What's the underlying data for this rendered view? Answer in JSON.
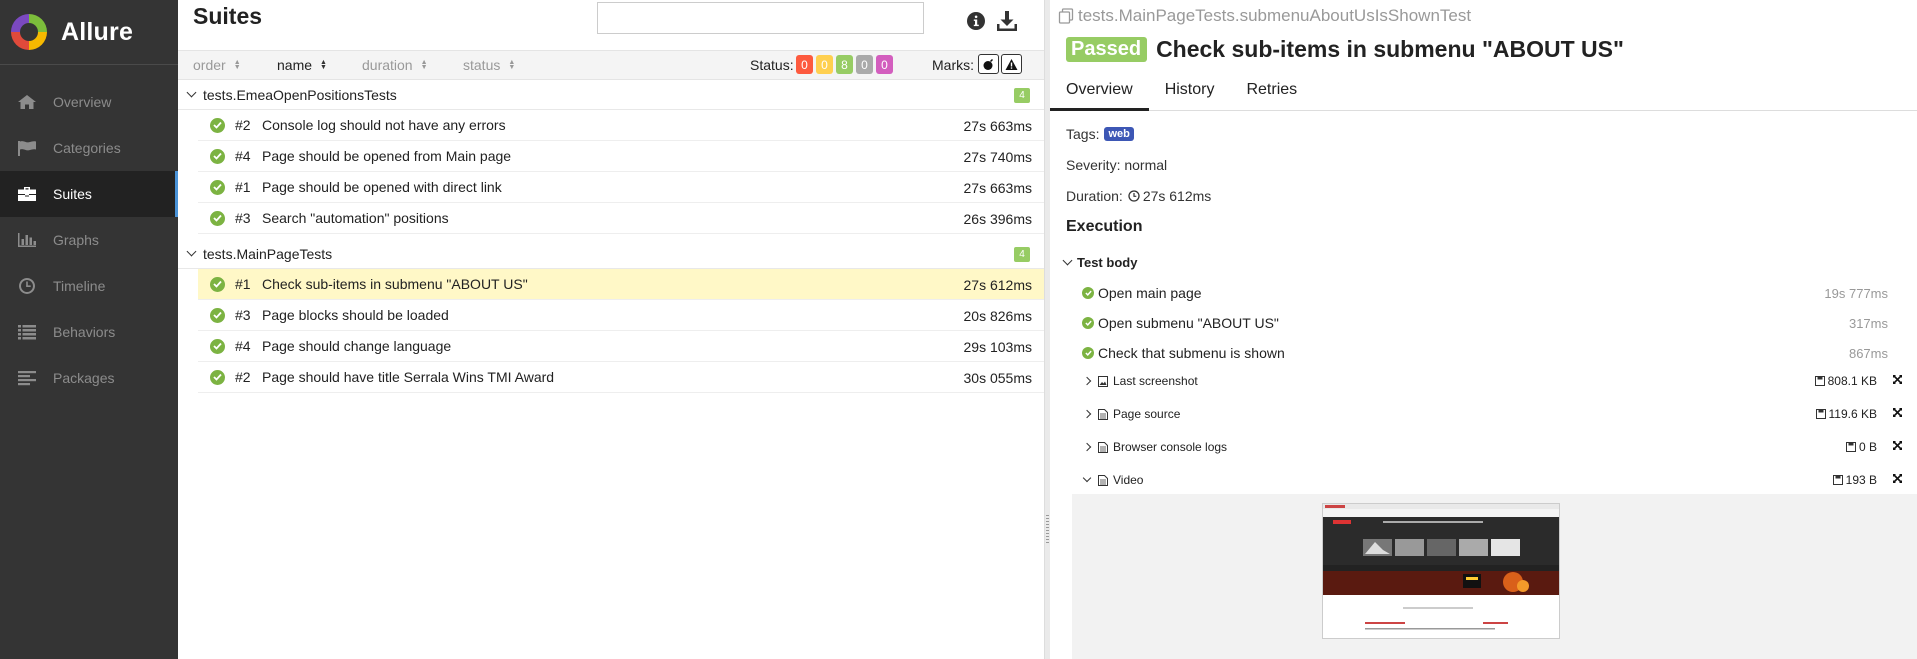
{
  "app": {
    "brand": "Allure",
    "nav": [
      {
        "label": "Overview",
        "icon": "home-icon"
      },
      {
        "label": "Categories",
        "icon": "flag-icon"
      },
      {
        "label": "Suites",
        "icon": "briefcase-icon",
        "active": true
      },
      {
        "label": "Graphs",
        "icon": "bar-chart-icon"
      },
      {
        "label": "Timeline",
        "icon": "clock-icon"
      },
      {
        "label": "Behaviors",
        "icon": "list-icon"
      },
      {
        "label": "Packages",
        "icon": "align-left-icon"
      }
    ]
  },
  "suites": {
    "title": "Suites",
    "search_value": "",
    "sort": {
      "order": "order",
      "name": "name",
      "duration": "duration",
      "status": "status"
    },
    "status_label": "Status:",
    "status_counts": [
      {
        "value": "0",
        "color": "#fd5a3e"
      },
      {
        "value": "0",
        "color": "#ffd050"
      },
      {
        "value": "8",
        "color": "#97cc64"
      },
      {
        "value": "0",
        "color": "#aaaaaa"
      },
      {
        "value": "0",
        "color": "#d35ebe"
      }
    ],
    "marks_label": "Marks:",
    "groups": [
      {
        "name": "tests.EmeaOpenPositionsTests",
        "count": "4",
        "tests": [
          {
            "num": "#2",
            "name": "Console log should not have any errors",
            "duration": "27s 663ms"
          },
          {
            "num": "#4",
            "name": "Page should be opened from Main page",
            "duration": "27s 740ms"
          },
          {
            "num": "#1",
            "name": "Page should be opened with direct link",
            "duration": "27s 663ms"
          },
          {
            "num": "#3",
            "name": "Search \"automation\" positions",
            "duration": "26s 396ms"
          }
        ]
      },
      {
        "name": "tests.MainPageTests",
        "count": "4",
        "tests": [
          {
            "num": "#1",
            "name": "Check sub-items in submenu \"ABOUT US\"",
            "duration": "27s 612ms"
          },
          {
            "num": "#3",
            "name": "Page blocks should be loaded",
            "duration": "20s 826ms"
          },
          {
            "num": "#4",
            "name": "Page should change language",
            "duration": "29s 103ms"
          },
          {
            "num": "#2",
            "name": "Page should have title Serrala Wins TMI Award",
            "duration": "30s 055ms"
          }
        ]
      }
    ]
  },
  "detail": {
    "breadcrumb": "tests.MainPageTests.submenuAboutUsIsShownTest",
    "status": "Passed",
    "title": "Check sub-items in submenu \"ABOUT US\"",
    "tabs": [
      "Overview",
      "History",
      "Retries"
    ],
    "tags_label": "Tags:",
    "tag": "web",
    "severity": "Severity: normal",
    "duration_label": "Duration:",
    "duration_value": "27s 612ms",
    "execution_title": "Execution",
    "test_body_title": "Test body",
    "steps": [
      {
        "name": "Open main page",
        "duration": "19s 777ms"
      },
      {
        "name": "Open submenu \"ABOUT US\"",
        "duration": "317ms"
      },
      {
        "name": "Check that submenu is shown",
        "duration": "867ms"
      }
    ],
    "attachments": [
      {
        "name": "Last screenshot",
        "size": "808.1 KB",
        "icon": "image-icon"
      },
      {
        "name": "Page source",
        "size": "119.6 KB",
        "icon": "file-icon"
      },
      {
        "name": "Browser console logs",
        "size": "0 B",
        "icon": "file-icon"
      },
      {
        "name": "Video",
        "size": "193 B",
        "icon": "file-icon",
        "open": true
      }
    ]
  }
}
